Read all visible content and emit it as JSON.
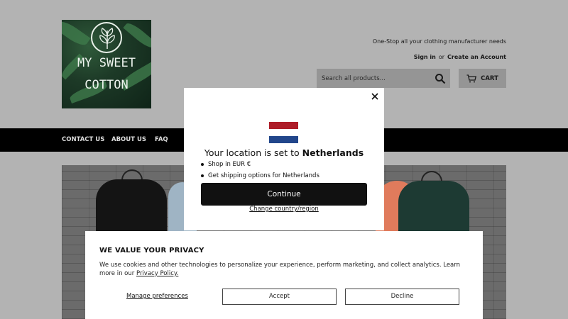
{
  "header": {
    "logo_line1": "MY SWEET",
    "logo_line2": "COTTON",
    "tagline": "One-Stop all your clothing manufacturer needs",
    "sign_in": "Sign in",
    "or": "or",
    "create_account": "Create an Account",
    "search_placeholder": "Search all products...",
    "cart_label": "CART"
  },
  "nav": {
    "items": [
      "CONTACT US",
      "ABOUT US",
      "FAQ"
    ]
  },
  "location_modal": {
    "title_prefix": "Your location is set to",
    "country": "Netherlands",
    "bullets": [
      "Shop in EUR €",
      "Get shipping options for Netherlands"
    ],
    "continue_label": "Continue",
    "change_label": "Change country/region",
    "flag_colors": [
      "#ae1c28",
      "#ffffff",
      "#21468b"
    ]
  },
  "privacy": {
    "title": "WE VALUE YOUR PRIVACY",
    "body": "We use cookies and other technologies to personalize your experience, perform marketing, and collect analytics. Learn more in our",
    "policy_link": "Privacy Policy.",
    "manage_label": "Manage preferences",
    "accept_label": "Accept",
    "decline_label": "Decline"
  },
  "colors": {
    "overlay": "#b3b3b3",
    "navbar": "#000000",
    "button_dark": "#111111"
  }
}
